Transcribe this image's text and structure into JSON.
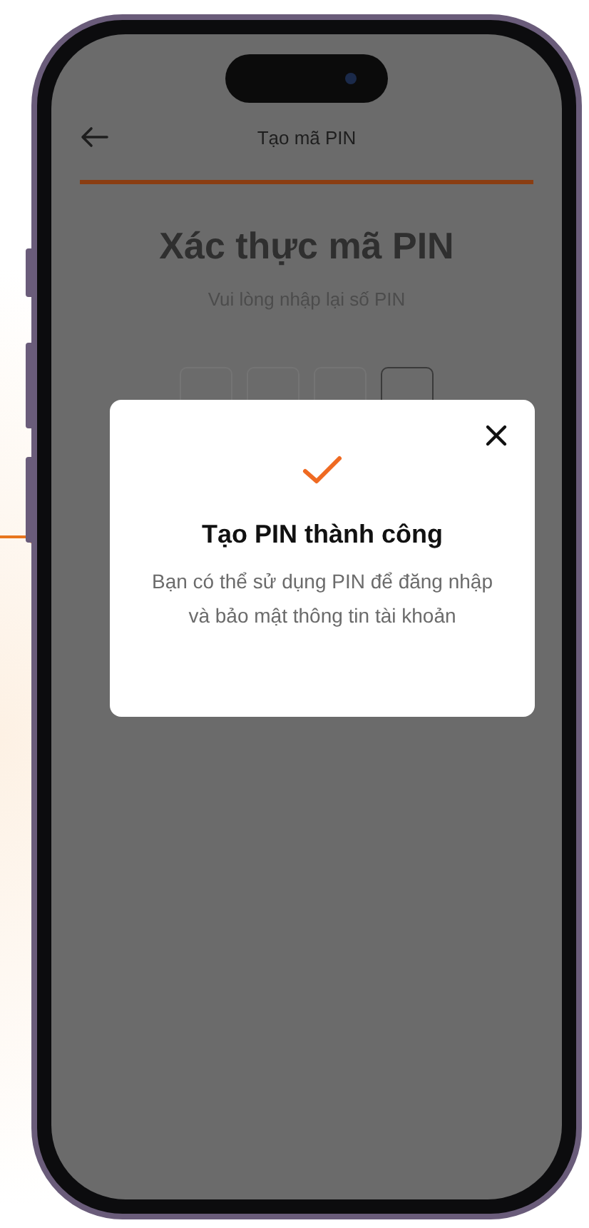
{
  "header": {
    "title": "Tạo mã PIN"
  },
  "progress": {
    "level": 1
  },
  "heading": "Xác thực mã PIN",
  "subtitle": "Vui lòng nhập lại số PIN",
  "pin_boxes": [
    {
      "focused": false
    },
    {
      "focused": false
    },
    {
      "focused": false
    },
    {
      "focused": true
    }
  ],
  "dialog": {
    "title": "Tạo PIN thành công",
    "message": "Bạn có thể sử dụng PIN để đăng nhập và bảo mật thông tin tài khoản"
  }
}
